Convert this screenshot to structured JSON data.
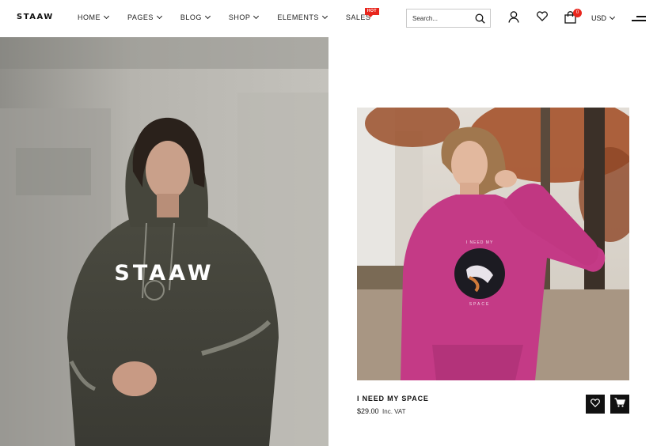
{
  "header": {
    "logo": "STAAW",
    "nav": [
      {
        "label": "HOME",
        "has_dropdown": true
      },
      {
        "label": "PAGES",
        "has_dropdown": true
      },
      {
        "label": "BLOG",
        "has_dropdown": true
      },
      {
        "label": "SHOP",
        "has_dropdown": true
      },
      {
        "label": "ELEMENTS",
        "has_dropdown": true
      },
      {
        "label": "SALES",
        "has_dropdown": false,
        "badge": "HOT"
      }
    ],
    "search": {
      "placeholder": "Search..."
    },
    "icons": [
      "user-icon",
      "heart-icon",
      "shopping-bag-icon"
    ],
    "cart_count": "0",
    "currency": "USD",
    "badge_color": "#e8261d"
  },
  "hero": {
    "title": "STAAW"
  },
  "product": {
    "name": "I NEED MY SPACE",
    "price": "$29.00",
    "tax_note": "Inc. VAT",
    "hoodie_print_top": "I NEED MY",
    "hoodie_print_bottom": "SPACE",
    "hoodie_color": "#c43a86"
  }
}
